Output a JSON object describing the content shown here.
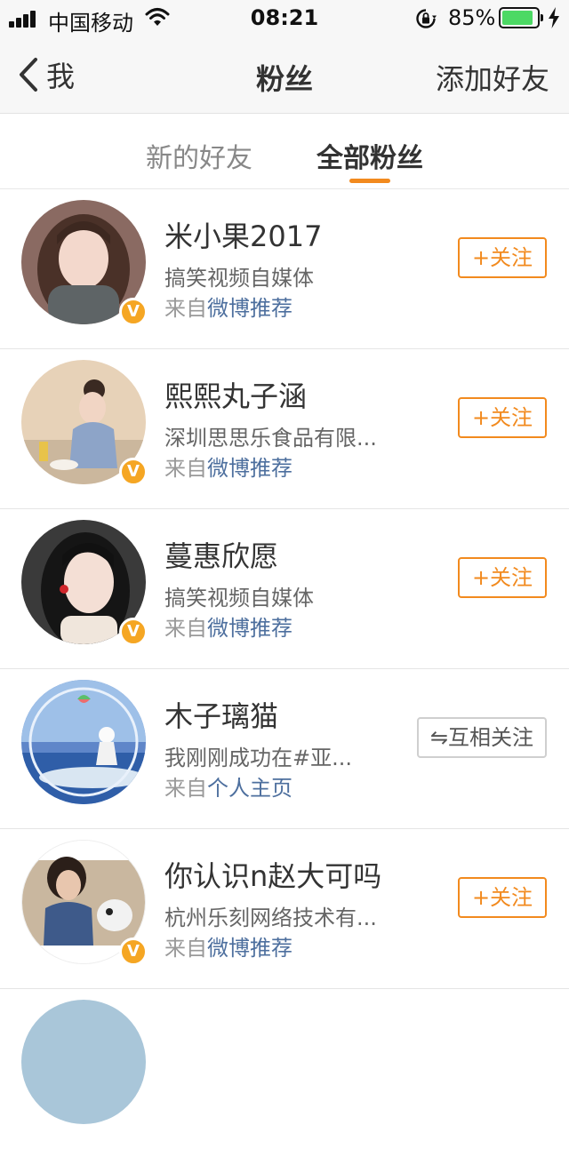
{
  "status_bar": {
    "carrier": "中国移动",
    "time": "08:21",
    "battery": "85%"
  },
  "nav": {
    "back_label": "我",
    "title": "粉丝",
    "right_action": "添加好友"
  },
  "tabs": [
    {
      "label": "新的好友"
    },
    {
      "label": "全部粉丝"
    }
  ],
  "fans": [
    {
      "name": "米小果2017",
      "desc": "搞笑视频自媒体",
      "source_prefix": "来自",
      "source": "微博推荐",
      "verified": true,
      "button": "+关注"
    },
    {
      "name": "熙熙丸子涵",
      "desc": "深圳思思乐食品有限...",
      "source_prefix": "来自",
      "source": "微博推荐",
      "verified": true,
      "button": "+关注"
    },
    {
      "name": "蔓惠欣愿",
      "desc": "搞笑视频自媒体",
      "source_prefix": "来自",
      "source": "微博推荐",
      "verified": true,
      "button": "+关注"
    },
    {
      "name": "木子璃猫",
      "desc": "我刚刚成功在#亚...",
      "source_prefix": "来自",
      "source": "个人主页",
      "verified": false,
      "button": "⇋互相关注"
    },
    {
      "name": "你认识n赵大可吗",
      "desc": "杭州乐刻网络技术有...",
      "source_prefix": "来自",
      "source": "微博推荐",
      "verified": true,
      "button": "+关注"
    }
  ],
  "colors": {
    "accent": "#f28a1e",
    "link": "#4d6f9e",
    "verified": "#f5a623",
    "battery": "#4cd964"
  }
}
